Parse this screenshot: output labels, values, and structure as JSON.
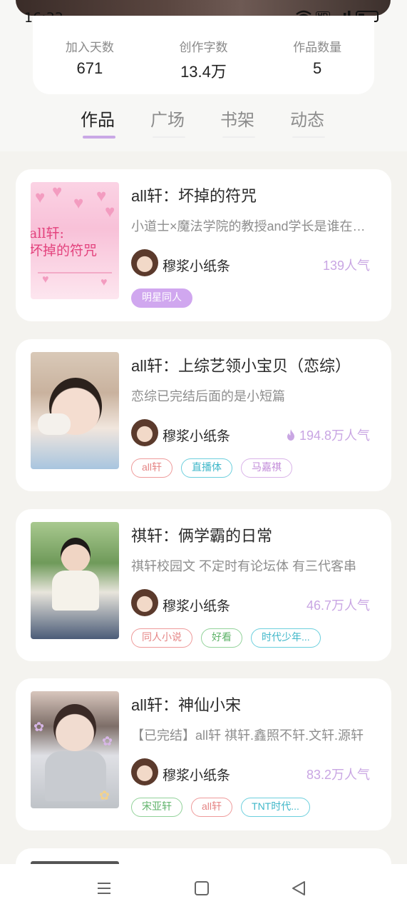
{
  "status_bar": {
    "time": "16:33",
    "hd_label": "HD"
  },
  "stats": [
    {
      "label": "加入天数",
      "value": "671"
    },
    {
      "label": "创作字数",
      "value": "13.4万"
    },
    {
      "label": "作品数量",
      "value": "5"
    }
  ],
  "tabs": [
    "作品",
    "广场",
    "书架",
    "动态"
  ],
  "active_tab": "作品",
  "works": [
    {
      "title": "all轩：坏掉的符咒",
      "desc": "小道士×魔法学院的教授and学长是谁在写我不说",
      "author": "穆浆小纸条",
      "popularity": "139人气",
      "hot": false,
      "cover_text": "all轩:\n坏掉的符咒",
      "tags": [
        {
          "label": "明星同人",
          "style": "filled"
        }
      ]
    },
    {
      "title": "all轩：上综艺领小宝贝（恋综）",
      "desc": "恋综已完结后面的是小短篇",
      "author": "穆浆小纸条",
      "popularity": "194.8万人气",
      "hot": true,
      "tags": [
        {
          "label": "all轩",
          "style": "red"
        },
        {
          "label": "直播体",
          "style": "cyan"
        },
        {
          "label": "马嘉祺",
          "style": "purple"
        }
      ]
    },
    {
      "title": "祺轩：俩学霸的日常",
      "desc": "祺轩校园文 不定时有论坛体 有三代客串",
      "author": "穆浆小纸条",
      "popularity": "46.7万人气",
      "hot": false,
      "tags": [
        {
          "label": "同人小说",
          "style": "red"
        },
        {
          "label": "好看",
          "style": "green"
        },
        {
          "label": "时代少年...",
          "style": "cyan"
        }
      ]
    },
    {
      "title": "all轩：神仙小宋",
      "desc": "【已完结】all轩  祺轩.鑫照不轩.文轩.源轩",
      "author": "穆浆小纸条",
      "popularity": "83.2万人气",
      "hot": false,
      "tags": [
        {
          "label": "宋亚轩",
          "style": "green"
        },
        {
          "label": "all轩",
          "style": "red"
        },
        {
          "label": "TNT时代...",
          "style": "cyan"
        }
      ]
    }
  ],
  "colors": {
    "accent": "#c9a8e6",
    "popularity": "#c9a6e3",
    "background": "#f4f3ef",
    "card": "#ffffff"
  },
  "nav_icons": [
    "menu-icon",
    "home-square-icon",
    "back-triangle-icon"
  ]
}
